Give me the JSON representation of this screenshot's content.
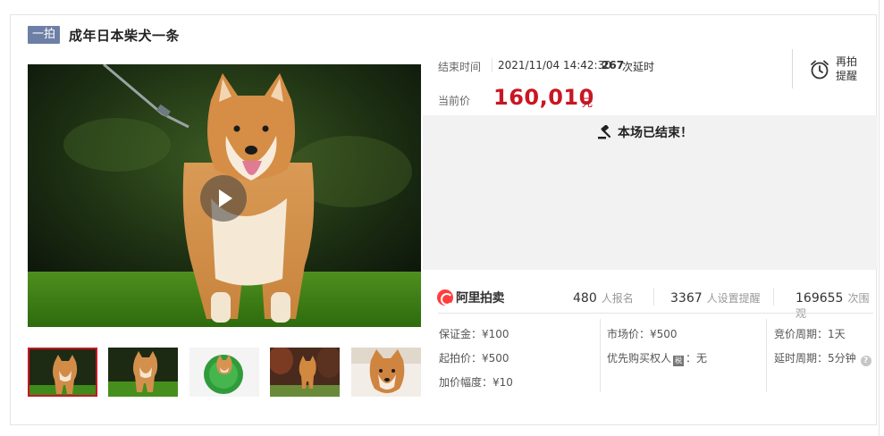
{
  "header": {
    "badge": "一拍",
    "title": "成年日本柴犬一条"
  },
  "status": {
    "end_label": "结束时间",
    "end_time": "2021/11/04 14:42:30",
    "delay_count": "267",
    "delay_label": "次延时",
    "remind_label": "再拍提醒"
  },
  "price": {
    "label": "当前价",
    "value": "160,010",
    "unit": "元"
  },
  "ended": {
    "message": "本场已结束！"
  },
  "stats": {
    "logo_text": "阿里拍卖",
    "signups": "480",
    "signups_label": "人报名",
    "reminders": "3367",
    "reminders_label": "人设置提醒",
    "viewers": "169655",
    "viewers_label": "次围观"
  },
  "details": {
    "deposit": "保证金：¥100",
    "start_price": "起拍价：¥500",
    "increment": "加价幅度：¥10",
    "market_price": "市场价：¥500",
    "priority_label": "优先购买权人",
    "tax_tag": "税",
    "priority_value": "：无",
    "bid_period": "竞价周期：1天",
    "delay_period": "延时周期：5分钟"
  },
  "colors": {
    "accent": "#c81623",
    "badge": "#6e7fa6",
    "panel": "#f2f2f2"
  },
  "icons": [
    "play-icon",
    "alarm-clock-icon",
    "gavel-icon",
    "help-icon",
    "alipaimai-logo"
  ]
}
